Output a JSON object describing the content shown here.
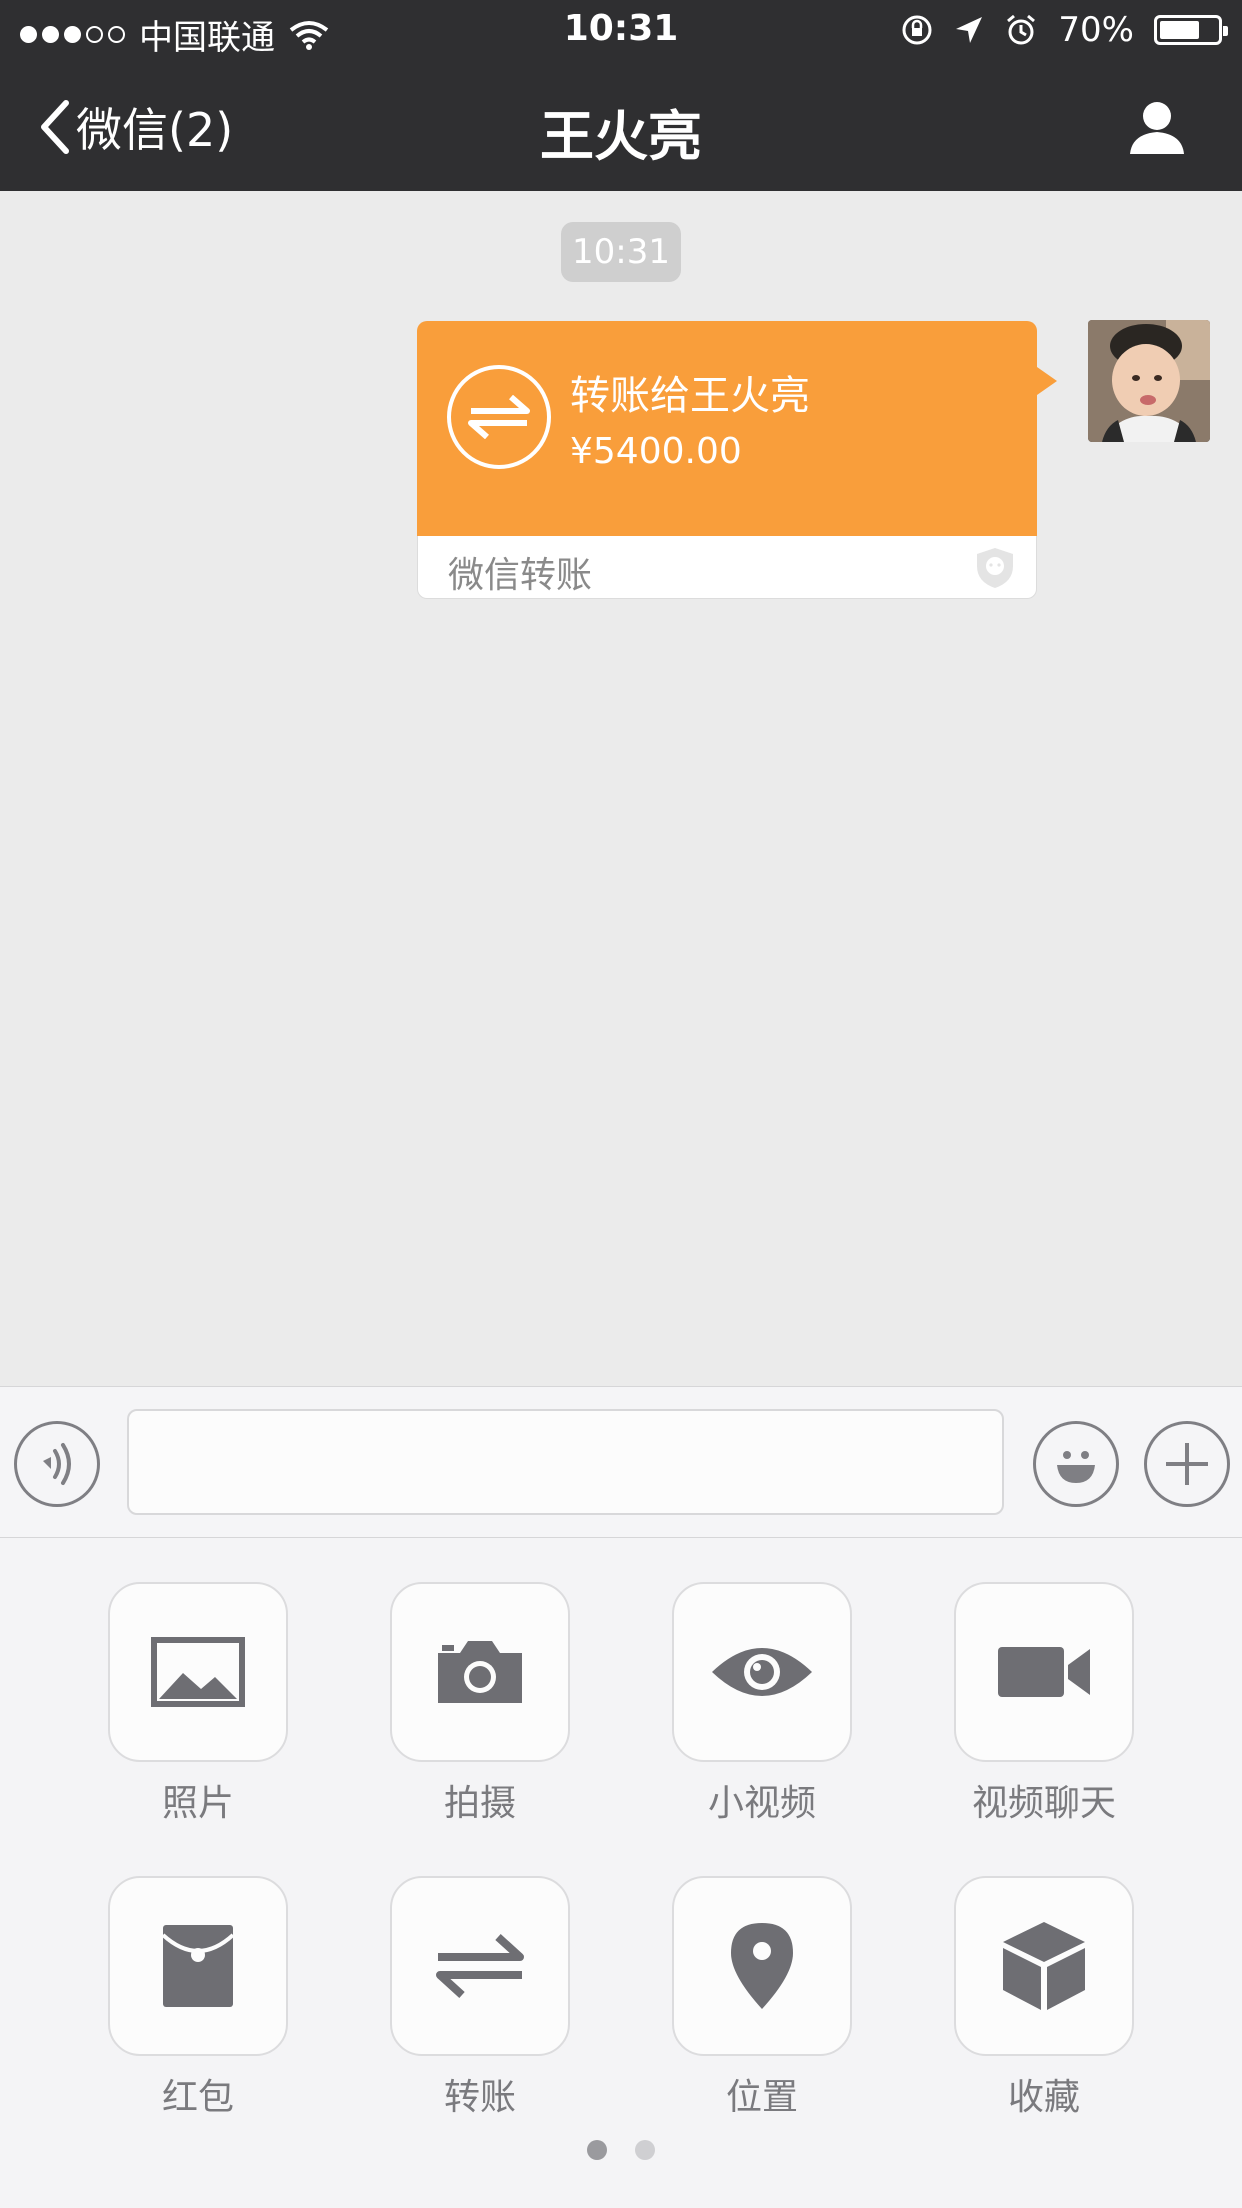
{
  "status_bar": {
    "carrier": "中国联通",
    "time": "10:31",
    "battery": "70%",
    "battery_level": 0.7
  },
  "nav": {
    "back_label": "微信(2)",
    "title": "王火亮"
  },
  "chat": {
    "timestamp": "10:31",
    "transfer": {
      "title": "转账给王火亮",
      "amount": "¥5400.00",
      "footer": "微信转账",
      "accent": "#f99e3b"
    }
  },
  "panel": {
    "items": [
      {
        "label": "照片",
        "icon": "photo-icon"
      },
      {
        "label": "拍摄",
        "icon": "camera-icon"
      },
      {
        "label": "小视频",
        "icon": "eye-icon"
      },
      {
        "label": "视频聊天",
        "icon": "video-camera-icon"
      },
      {
        "label": "红包",
        "icon": "red-packet-icon"
      },
      {
        "label": "转账",
        "icon": "transfer-icon"
      },
      {
        "label": "位置",
        "icon": "location-pin-icon"
      },
      {
        "label": "收藏",
        "icon": "cube-icon"
      }
    ],
    "pages": 2,
    "current_page": 1
  }
}
